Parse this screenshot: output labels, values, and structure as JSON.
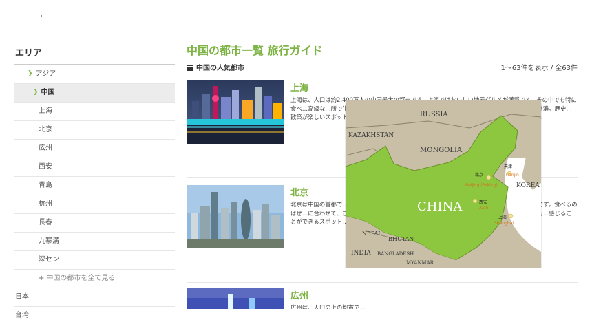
{
  "sidebar": {
    "title": "エリア",
    "region": "アジア",
    "country": "中国",
    "cities": [
      "上海",
      "北京",
      "広州",
      "西安",
      "青島",
      "杭州",
      "長春",
      "九寨溝",
      "深セン"
    ],
    "see_all": "中国の都市を全て見る",
    "other_countries": [
      "日本",
      "台湾"
    ]
  },
  "main": {
    "title": "中国の都市一覧 旅行ガイド",
    "subheading": "中国の人気都市",
    "result_count": "1〜63件を表示 / 全63件"
  },
  "cities": [
    {
      "name": "上海",
      "description": "上海は、人口は約2,400万人の中国最大の都市です。上海ではおいしい地元グルメが満載です。その中でも特に食べ…高級な…所で生育されています。た…い皮の中に餡とスープが包ま…番の観光スポットは外灘。歴史…散策が楽しいスポットです。…ます。また、上海雑技団の演技も…ばなしで大興奮の時間を過ご…"
    },
    {
      "name": "北京",
      "description": "北京は中国の首都で…のひとつは北京ダック。丁寧…に一緒に甜麺醤等のタレを付…北京グルメです。食べるのはぜ…に合わせて、こねたり引っ張…られません。有名な観光地…ています。城壁の遺跡である万…感じることができるスポット…"
    },
    {
      "name": "広州",
      "description": "広州は、人口の上の都市で…"
    }
  ],
  "map": {
    "countries": [
      "RUSSIA",
      "KAZAKHSTAN",
      "MONGOLIA",
      "CHINA",
      "KOREA",
      "NEPAL",
      "BHUTAN",
      "INDIA",
      "BANGLADESH",
      "MYANMAR"
    ],
    "cities": [
      {
        "ja": "北京",
        "en": "Beijing (Peking)"
      },
      {
        "ja": "天津",
        "en": "Tianjin"
      },
      {
        "ja": "西安",
        "en": "Xian"
      },
      {
        "ja": "上海",
        "en": "Shanghai"
      }
    ],
    "colors": {
      "china": "#8dc63f",
      "land": "#c8bfa6",
      "sea": "#ffffff",
      "city_dot": "#f2e29a",
      "city_label": "#d4731b"
    }
  }
}
